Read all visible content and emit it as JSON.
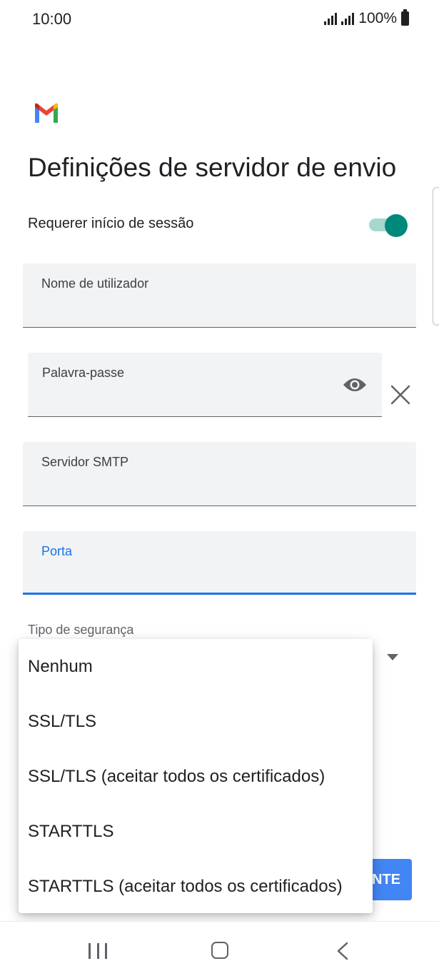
{
  "status_bar": {
    "time": "10:00",
    "battery": "100%"
  },
  "header": {
    "logo": "gmail-logo",
    "title": "Definições de servidor de envio"
  },
  "require_login": {
    "label": "Requerer início de sessão",
    "enabled": true
  },
  "fields": {
    "username": {
      "label": "Nome de utilizador",
      "value": ""
    },
    "password": {
      "label": "Palavra-passe",
      "value": ""
    },
    "smtp_server": {
      "label": "Servidor SMTP",
      "value": ""
    },
    "port": {
      "label": "Porta",
      "value": ""
    }
  },
  "security": {
    "label": "Tipo de segurança",
    "options": [
      "Nenhum",
      "SSL/TLS",
      "SSL/TLS (aceitar todos os certificados)",
      "STARTTLS",
      "STARTTLS (aceitar todos os certificados)"
    ]
  },
  "next_button": {
    "label": "NTE"
  },
  "colors": {
    "accent": "#1a73e8",
    "toggle_on": "#00897b",
    "button": "#4285f4"
  }
}
